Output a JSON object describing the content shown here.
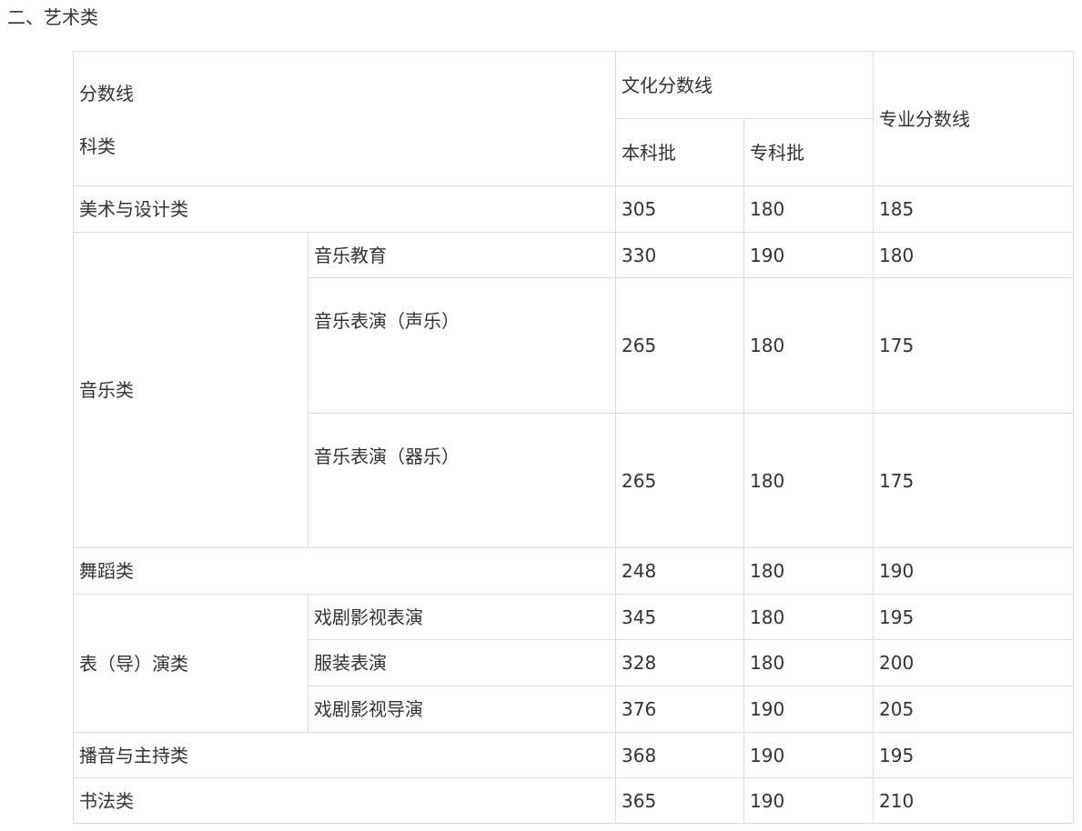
{
  "section_title": "二、艺术类",
  "header": {
    "corner_top": "分数线",
    "corner_bottom": "科类",
    "culture_line": "文化分数线",
    "undergrad": "本科批",
    "junior": "专科批",
    "professional_line": "专业分数线"
  },
  "rows": {
    "art_design": {
      "label": "美术与设计类",
      "undergrad": "305",
      "junior": "180",
      "professional": "185"
    },
    "music": {
      "label": "音乐类",
      "subs": [
        {
          "label": "音乐教育",
          "undergrad": "330",
          "junior": "190",
          "professional": "180"
        },
        {
          "label": "音乐表演（声乐）",
          "undergrad": "265",
          "junior": "180",
          "professional": "175"
        },
        {
          "label": "音乐表演（器乐）",
          "undergrad": "265",
          "junior": "180",
          "professional": "175"
        }
      ]
    },
    "dance": {
      "label": "舞蹈类",
      "undergrad": "248",
      "junior": "180",
      "professional": "190"
    },
    "perform": {
      "label": "表（导）演类",
      "subs": [
        {
          "label": "戏剧影视表演",
          "undergrad": "345",
          "junior": "180",
          "professional": "195"
        },
        {
          "label": "服装表演",
          "undergrad": "328",
          "junior": "180",
          "professional": "200"
        },
        {
          "label": "戏剧影视导演",
          "undergrad": "376",
          "junior": "190",
          "professional": "205"
        }
      ]
    },
    "broadcast": {
      "label": "播音与主持类",
      "undergrad": "368",
      "junior": "190",
      "professional": "195"
    },
    "calligraphy": {
      "label": "书法类",
      "undergrad": "365",
      "junior": "190",
      "professional": "210"
    }
  }
}
